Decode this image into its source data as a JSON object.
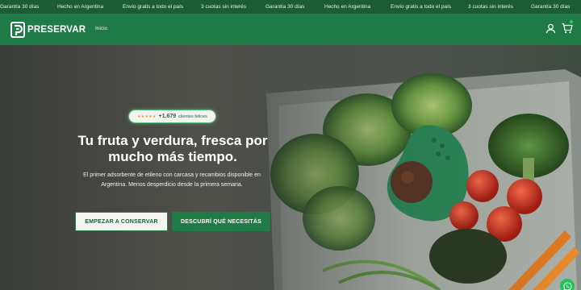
{
  "ticker": {
    "items": [
      "Garantía 30 días",
      "Hecho en Argentina",
      "Envío gratis a todo el país",
      "3 cuotas sin interés",
      "Garantía 30 días",
      "Hecho en Argentina",
      "Envío gratis a todo el país",
      "3 cuotas sin interés",
      "Garantía 30 días"
    ]
  },
  "header": {
    "logo_text": "PRESERVAR",
    "nav": {
      "home_label": "Inicio"
    },
    "icons": {
      "account": "user-icon",
      "cart": "cart-icon"
    },
    "colors": {
      "brand": "#1f7a45",
      "ticker": "#1a5c36",
      "badge": "#26d06a"
    }
  },
  "hero": {
    "rating": {
      "stars": "★★★★★",
      "count": "+1.679",
      "label": "clientes felices"
    },
    "headline": "Tu fruta y verdura, fresca por mucho más tiempo.",
    "subtext": "El primer adsorbente de etileno con carcasa y recambios disponible en Argentina. Menos desperdicio desde la primera semana.",
    "primary_cta": "EMPEZAR A CONSERVAR",
    "secondary_cta": "DESCUBRÍ QUÉ NECESITÁS"
  },
  "floating": {
    "whatsapp_icon": "whatsapp-icon"
  }
}
